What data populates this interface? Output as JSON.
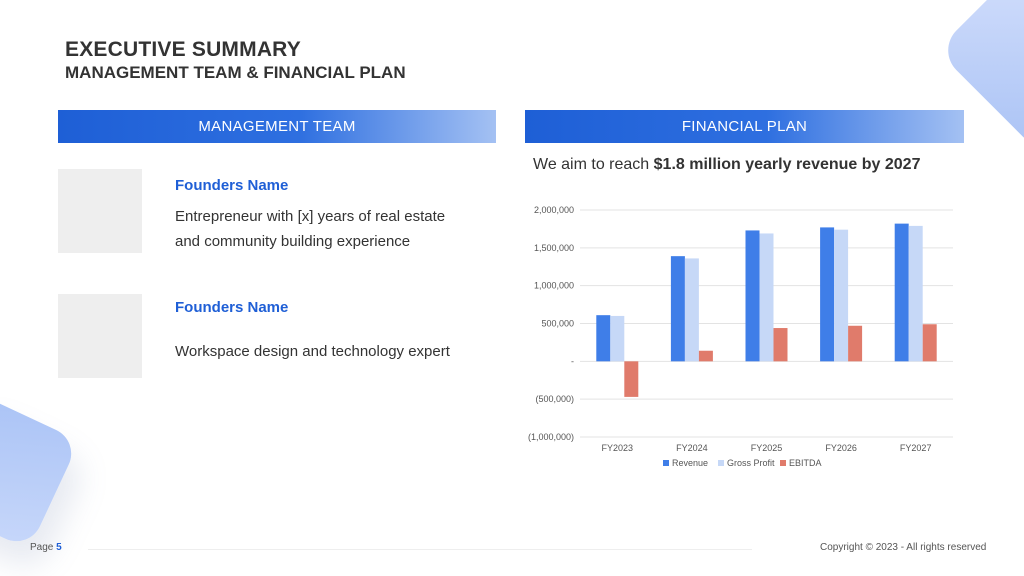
{
  "header": {
    "title": "EXECUTIVE SUMMARY",
    "subtitle": "MANAGEMENT TEAM & FINANCIAL PLAN"
  },
  "management": {
    "heading": "MANAGEMENT TEAM",
    "members": [
      {
        "name": "Founders Name",
        "desc_line1": "Entrepreneur with [x] years of real estate",
        "desc_line2": "and community building experience"
      },
      {
        "name": "Founders Name",
        "desc_line1": "Workspace design and technology expert"
      }
    ]
  },
  "financial": {
    "heading": "FINANCIAL PLAN",
    "aim_prefix": "We aim to reach ",
    "aim_highlight": "$1.8 million yearly revenue by 2027"
  },
  "chart_data": {
    "type": "bar",
    "categories": [
      "FY2023",
      "FY2024",
      "FY2025",
      "FY2026",
      "FY2027"
    ],
    "series": [
      {
        "name": "Revenue",
        "values": [
          610000,
          1390000,
          1730000,
          1770000,
          1820000
        ],
        "color": "#3f7ee8"
      },
      {
        "name": "Gross Profit",
        "values": [
          600000,
          1360000,
          1690000,
          1740000,
          1790000
        ],
        "color": "#c6d8f7"
      },
      {
        "name": "EBITDA",
        "values": [
          -470000,
          140000,
          440000,
          470000,
          490000
        ],
        "color": "#e07b6b"
      }
    ],
    "yticks": [
      2000000,
      1500000,
      1000000,
      500000,
      0,
      -500000,
      -1000000
    ],
    "ytick_labels": [
      "2,000,000",
      "1,500,000",
      "1,000,000",
      "500,000",
      "-",
      "(500,000)",
      "(1,000,000)"
    ],
    "ylim": [
      -1000000,
      2000000
    ],
    "grid": true,
    "legend": "bottom"
  },
  "footer": {
    "page_label": "Page",
    "page_number": "5",
    "copyright": "Copyright © 2023 - All rights reserved"
  }
}
